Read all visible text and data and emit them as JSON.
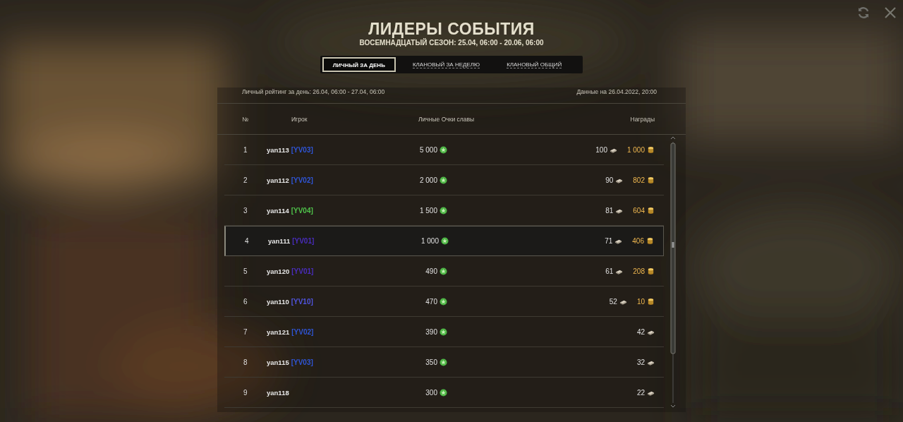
{
  "title": "ЛИДЕРЫ СОБЫТИЯ",
  "subtitle": "ВОСЕМНАДЦАТЫЙ СЕЗОН: 25.04, 06:00 - 20.06, 06:00",
  "tabs": [
    {
      "label": "ЛИЧНЫЙ ЗА ДЕНЬ",
      "selected": true
    },
    {
      "label": "КЛАНОВЫЙ ЗА НЕДЕЛЮ",
      "selected": false
    },
    {
      "label": "КЛАНОВЫЙ ОБЩИЙ",
      "selected": false
    }
  ],
  "period": "Личный рейтинг за день: 26.04, 06:00 - 27.04, 06:00",
  "updated": "Данные на 26.04.2022, 20:00",
  "table": {
    "columns": [
      "№",
      "Игрок",
      "Личные Очки славы",
      "Награды"
    ],
    "rows": [
      {
        "rank": "1",
        "player": "yan113",
        "clan": {
          "text": "[YV03]",
          "color": "#2f55d6"
        },
        "points": "5 000",
        "bonds": "100",
        "gold": "1 000",
        "selected": false
      },
      {
        "rank": "2",
        "player": "yan112",
        "clan": {
          "text": "[YV02]",
          "color": "#2f55d6"
        },
        "points": "2 000",
        "bonds": "90",
        "gold": "802",
        "selected": false
      },
      {
        "rank": "3",
        "player": "yan114",
        "clan": {
          "text": "[YV04]",
          "color": "#4fc24a"
        },
        "points": "1 500",
        "bonds": "81",
        "gold": "604",
        "selected": false
      },
      {
        "rank": "4",
        "player": "yan111",
        "clan": {
          "text": "[YV01]",
          "color": "#4a2dbf"
        },
        "points": "1 000",
        "bonds": "71",
        "gold": "406",
        "selected": true
      },
      {
        "rank": "5",
        "player": "yan120",
        "clan": {
          "text": "[YV01]",
          "color": "#4a2dbf"
        },
        "points": "490",
        "bonds": "61",
        "gold": "208",
        "selected": false
      },
      {
        "rank": "6",
        "player": "yan110",
        "clan": {
          "text": "[YV10]",
          "color": "#5055e0"
        },
        "points": "470",
        "bonds": "52",
        "gold": "10",
        "selected": false
      },
      {
        "rank": "7",
        "player": "yan121",
        "clan": {
          "text": "[YV02]",
          "color": "#2f55d6"
        },
        "points": "390",
        "bonds": "42",
        "selected": false
      },
      {
        "rank": "8",
        "player": "yan115",
        "clan": {
          "text": "[YV03]",
          "color": "#2f55d6"
        },
        "points": "350",
        "bonds": "32",
        "selected": false
      },
      {
        "rank": "9",
        "player": "yan118",
        "points": "300",
        "bonds": "22",
        "selected": false
      }
    ]
  }
}
